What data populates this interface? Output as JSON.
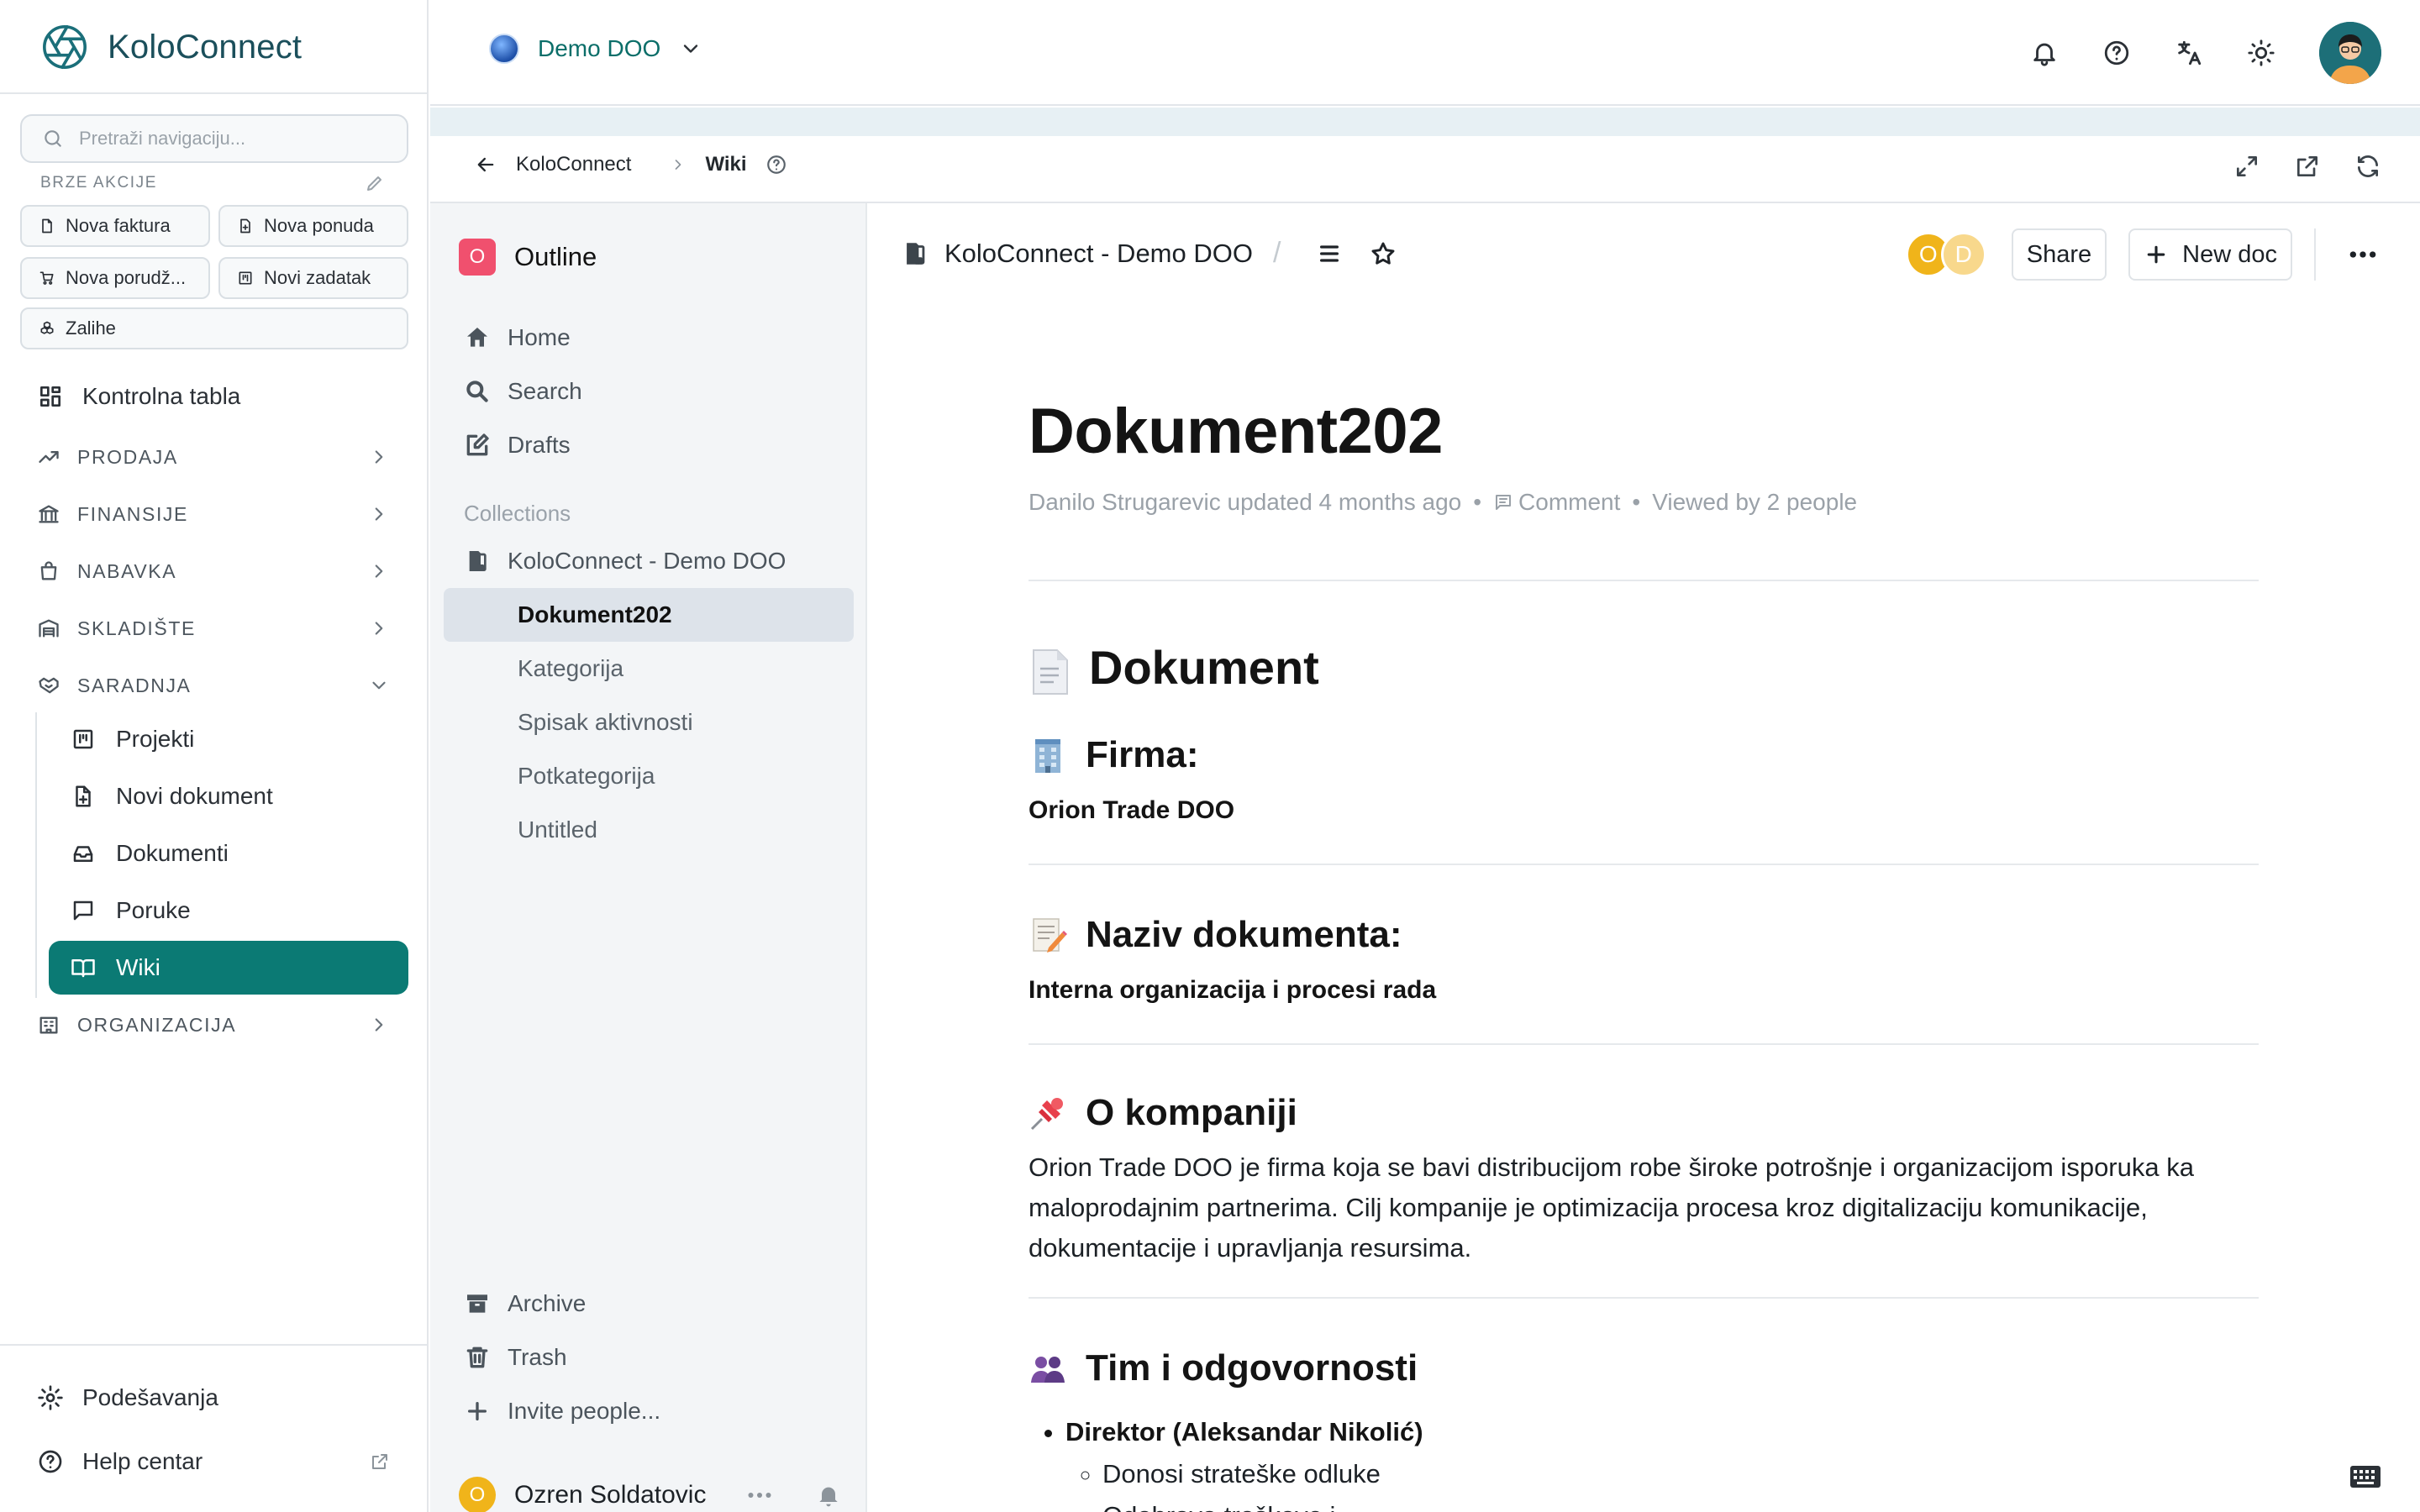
{
  "app": {
    "brand": "KoloConnect",
    "nav_search_placeholder": "Pretraži navigaciju...",
    "quick_actions_title": "BRZE AKCIJE",
    "quick_actions": [
      "Nova faktura",
      "Nova ponuda",
      "Nova porudž...",
      "Novi zadatak",
      "Zalihe"
    ],
    "nav": {
      "dashboard": "Kontrolna tabla",
      "sections": [
        "PRODAJA",
        "FINANSIJE",
        "NABAVKA",
        "SKLADIŠTE",
        "SARADNJA"
      ],
      "collab_items": [
        "Projekti",
        "Novi dokument",
        "Dokumenti",
        "Poruke",
        "Wiki"
      ],
      "org": "ORGANIZACIJA"
    },
    "footer": {
      "settings": "Podešavanja",
      "help": "Help centar"
    },
    "accent": "#0b7a74"
  },
  "topbar": {
    "company": "Demo DOO"
  },
  "frame": {
    "back_label": "KoloConnect",
    "current": "Wiki"
  },
  "outline": {
    "logo_letter": "O",
    "title": "Outline",
    "nav": [
      "Home",
      "Search",
      "Drafts"
    ],
    "collections_label": "Collections",
    "collection": "KoloConnect - Demo DOO",
    "docs": [
      "Dokument202",
      "Kategorija",
      "Spisak aktivnosti",
      "Potkategorija",
      "Untitled"
    ],
    "bottom": [
      "Archive",
      "Trash",
      "Invite people..."
    ],
    "user": {
      "initial": "O",
      "name": "Ozren Soldatovic"
    }
  },
  "document": {
    "collection": "KoloConnect - Demo DOO",
    "avatars": [
      "O",
      "D"
    ],
    "share": "Share",
    "new_doc": "New doc",
    "title": "Dokument202",
    "meta": {
      "updated": "Danilo Strugarevic updated 4 months ago",
      "comment": "Comment",
      "viewed": "Viewed by 2 people"
    },
    "h1": "Dokument",
    "firma_heading": "Firma:",
    "firma_value": "Orion Trade DOO",
    "naziv_heading": "Naziv dokumenta:",
    "naziv_value": "Interna organizacija i procesi rada",
    "about_heading": "O kompaniji",
    "about_text": "Orion Trade DOO je firma koja se bavi distribucijom robe široke potrošnje i organizacijom isporuka ka maloprodajnim partnerima. Cilj kompanije je optimizacija procesa kroz digitalizaciju komunikacije, dokumentacije i upravljanja resursima.",
    "team_heading": "Tim i odgovornosti",
    "team_item": "Direktor (Aleksandar Nikolić)",
    "team_subitems": [
      "Donosi strateške odluke",
      "Odobrava troškove i"
    ]
  }
}
